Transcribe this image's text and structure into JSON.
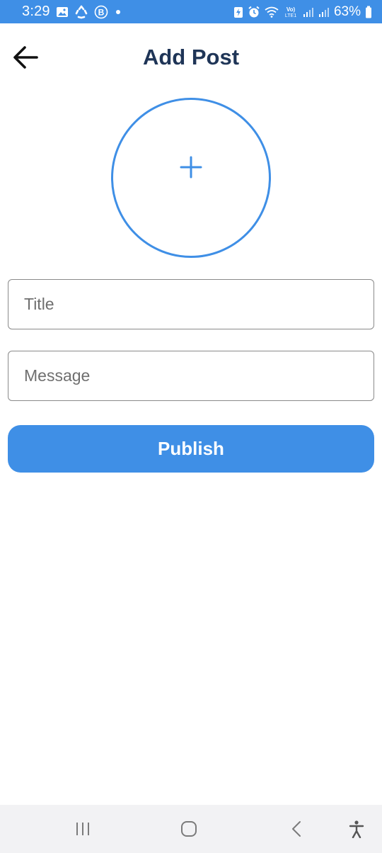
{
  "status_bar": {
    "time": "3:29",
    "left_icons": [
      "gallery-icon",
      "share-it-icon",
      "b-badge-icon",
      "dot-icon"
    ],
    "right_icons": [
      "battery-saver-icon",
      "alarm-icon",
      "wifi-icon",
      "volte-icon",
      "signal-icon",
      "signal-icon"
    ],
    "volte_label": "Vo) LTE1",
    "battery_percent": "63%",
    "background_color": "#3f8fe6"
  },
  "header": {
    "title": "Add Post",
    "back_icon": "arrow-left-icon",
    "title_color": "#1f3557"
  },
  "image_picker": {
    "icon": "plus-icon",
    "accent_color": "#3f8fe6"
  },
  "form": {
    "title_placeholder": "Title",
    "title_value": "",
    "message_placeholder": "Message",
    "message_value": ""
  },
  "actions": {
    "publish_label": "Publish",
    "publish_color": "#3f8fe6"
  },
  "nav_bar": {
    "items": [
      "recent-apps-icon",
      "home-icon",
      "back-icon",
      "accessibility-icon"
    ]
  }
}
